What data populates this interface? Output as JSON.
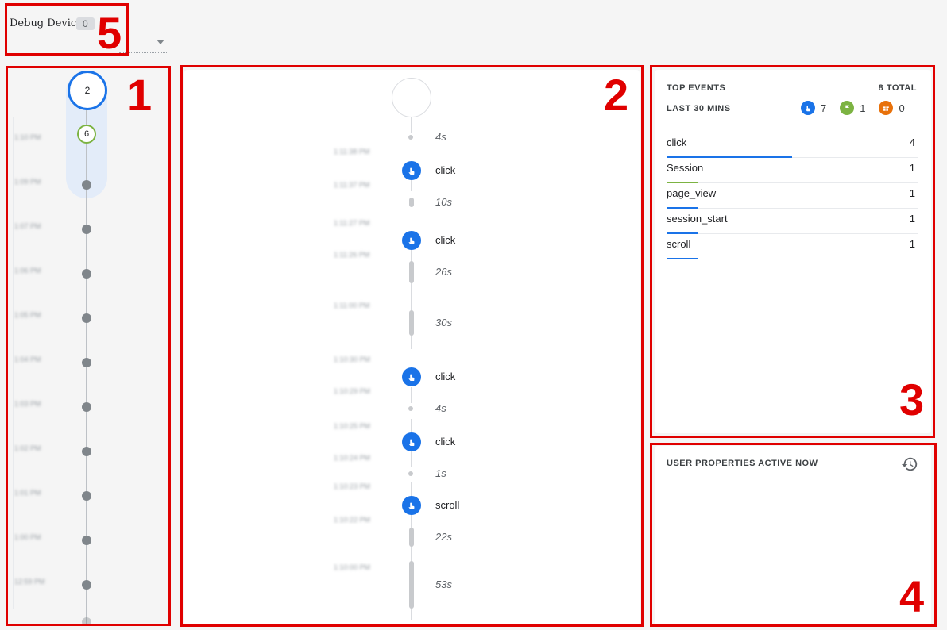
{
  "header": {
    "title": "Debug Device",
    "count": "0"
  },
  "annotations": [
    "1",
    "2",
    "3",
    "4",
    "5"
  ],
  "minutes_stream": {
    "top_count": "2",
    "sub_count": "6",
    "time_labels": [
      "1:10 PM",
      "1:09 PM",
      "1:07 PM",
      "1:06 PM",
      "1:05 PM",
      "1:04 PM",
      "1:03 PM",
      "1:02 PM",
      "1:01 PM",
      "1:00 PM",
      "12:59 PM"
    ]
  },
  "seconds_stream": {
    "events": [
      {
        "kind": "duration",
        "label": "4s"
      },
      {
        "kind": "event",
        "label": "click",
        "icon": "touch-icon"
      },
      {
        "kind": "duration",
        "label": "10s"
      },
      {
        "kind": "event",
        "label": "click",
        "icon": "touch-icon"
      },
      {
        "kind": "duration",
        "label": "26s"
      },
      {
        "kind": "duration",
        "label": "30s"
      },
      {
        "kind": "event",
        "label": "click",
        "icon": "touch-icon"
      },
      {
        "kind": "duration",
        "label": "4s"
      },
      {
        "kind": "event",
        "label": "click",
        "icon": "touch-icon"
      },
      {
        "kind": "duration",
        "label": "1s"
      },
      {
        "kind": "event",
        "label": "scroll",
        "icon": "touch-icon"
      },
      {
        "kind": "duration",
        "label": "22s"
      },
      {
        "kind": "duration",
        "label": "53s"
      }
    ],
    "timestamps": [
      "1:11:38 PM",
      "1:11:37 PM",
      "1:11:27 PM",
      "1:11:26 PM",
      "1:11:00 PM",
      "1:10:30 PM",
      "1:10:29 PM",
      "1:10:25 PM",
      "1:10:24 PM",
      "1:10:23 PM",
      "1:10:22 PM",
      "1:10:00 PM"
    ]
  },
  "top_events": {
    "title": "TOP EVENTS",
    "total": "8 TOTAL",
    "window": "LAST 30 MINS",
    "counts": [
      {
        "icon": "touch-icon",
        "value": "7",
        "color": "#1a73e8"
      },
      {
        "icon": "flag-icon",
        "value": "1",
        "color": "#7cb342"
      },
      {
        "icon": "gift-icon",
        "value": "0",
        "color": "#e8710a"
      }
    ],
    "rows": [
      {
        "name": "click",
        "count": "4",
        "bar_fraction": 0.5,
        "color": "#1a73e8"
      },
      {
        "name": "Session",
        "count": "1",
        "bar_fraction": 0.125,
        "color": "#7cb342"
      },
      {
        "name": "page_view",
        "count": "1",
        "bar_fraction": 0.125,
        "color": "#1a73e8"
      },
      {
        "name": "session_start",
        "count": "1",
        "bar_fraction": 0.125,
        "color": "#1a73e8"
      },
      {
        "name": "scroll",
        "count": "1",
        "bar_fraction": 0.125,
        "color": "#1a73e8"
      }
    ]
  },
  "user_properties": {
    "title": "USER PROPERTIES ACTIVE NOW",
    "icon": "history-icon"
  }
}
